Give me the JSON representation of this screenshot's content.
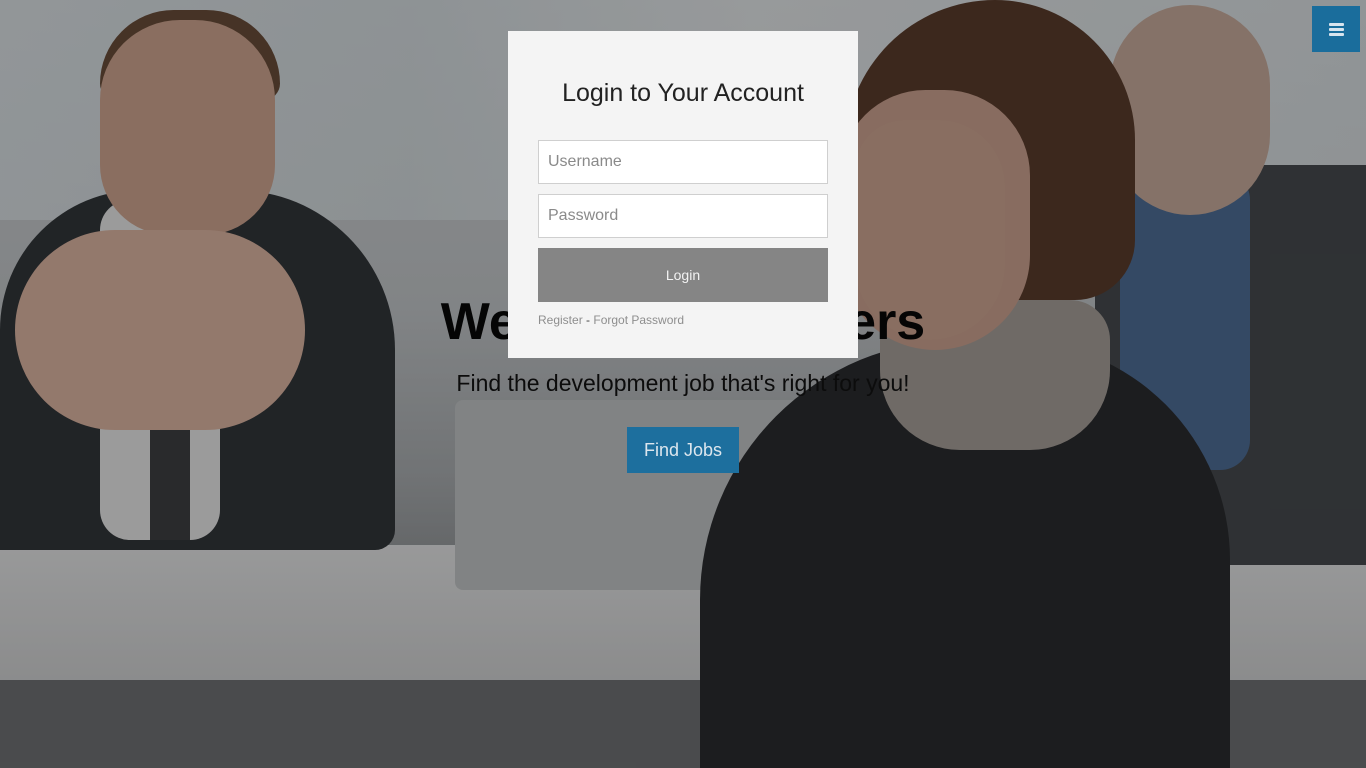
{
  "hero": {
    "title": "Welcome to Coders",
    "subtitle": "Find the development job that's right for you!",
    "cta_label": "Find Jobs"
  },
  "menu": {
    "icon": "hamburger-icon"
  },
  "login": {
    "title": "Login to Your Account",
    "username_placeholder": "Username",
    "password_placeholder": "Password",
    "button_label": "Login",
    "register_label": "Register",
    "separator": " - ",
    "forgot_label": "Forgot Password"
  },
  "colors": {
    "accent": "#1d6f9e",
    "login_button": "#858585",
    "modal_bg": "#f4f4f4"
  }
}
